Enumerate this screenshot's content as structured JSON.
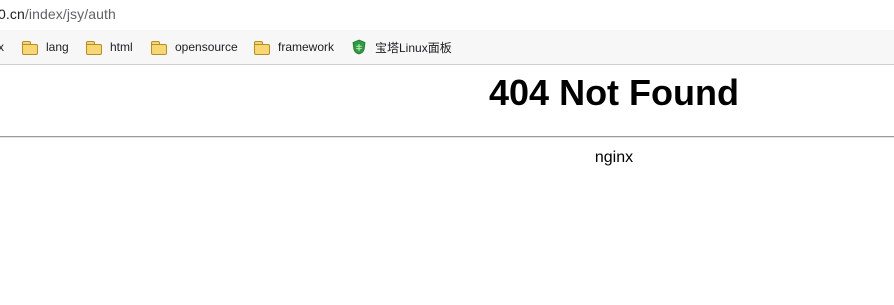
{
  "address_bar": {
    "url_host_fragment": "0.cn",
    "url_path": "/index/jsy/auth"
  },
  "bookmarks": [
    {
      "label": "x",
      "icon": "none"
    },
    {
      "label": "lang",
      "icon": "folder-icon"
    },
    {
      "label": "html",
      "icon": "folder-icon"
    },
    {
      "label": "opensource",
      "icon": "folder-icon"
    },
    {
      "label": "framework",
      "icon": "folder-icon"
    },
    {
      "label": "宝塔Linux面板",
      "icon": "shield-icon"
    }
  ],
  "page": {
    "title": "404 Not Found",
    "server": "nginx"
  },
  "colors": {
    "bookmark_bar_bg": "#f7f7f7",
    "folder_fill": "#f7d774",
    "shield_green": "#2e9b3e",
    "url_gray": "#5f6368"
  }
}
